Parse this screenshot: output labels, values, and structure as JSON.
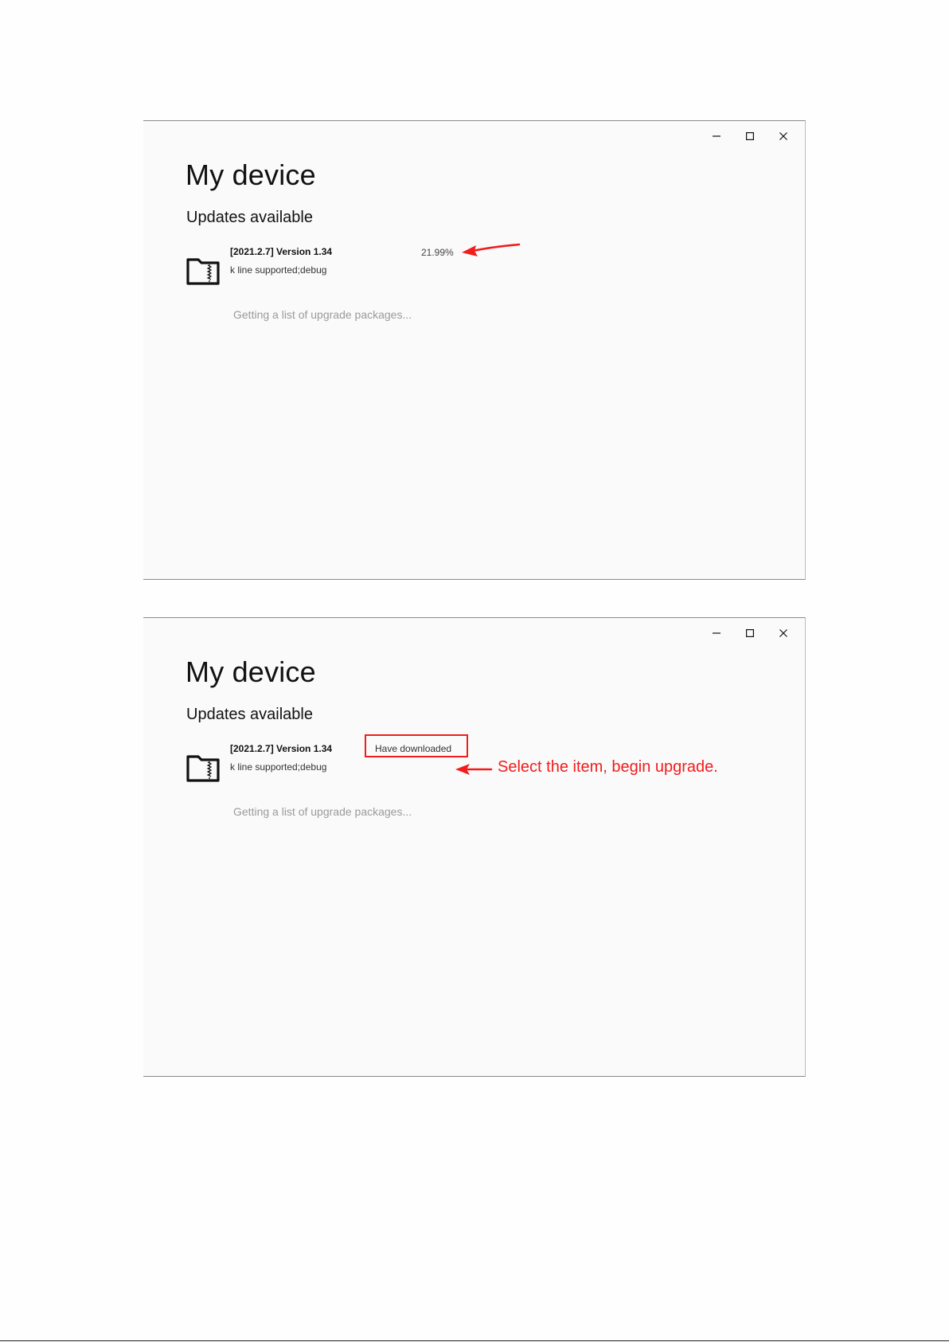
{
  "colors": {
    "annotation": "#f21c1c",
    "window_bg": "#fafafa",
    "muted_text": "#9a9a9a"
  },
  "window_controls": {
    "minimize_icon": "minimize-icon",
    "maximize_icon": "maximize-icon",
    "close_icon": "close-icon"
  },
  "screens": [
    {
      "app_title": "My device",
      "section_title": "Updates available",
      "package": {
        "icon": "sd-card-folder-icon",
        "title": "[2021.2.7] Version 1.34",
        "description": "k line supported;debug",
        "progress_text": "21.99%",
        "progress_value_percent": 21.99
      },
      "loading_text": "Getting a list of upgrade packages..."
    },
    {
      "app_title": "My device",
      "section_title": "Updates available",
      "package": {
        "icon": "sd-card-folder-icon",
        "title": "[2021.2.7] Version 1.34",
        "description": "k line supported;debug",
        "status_text": "Have downloaded"
      },
      "loading_text": "Getting a list of upgrade packages...",
      "annotation_text": "Select the item, begin upgrade."
    }
  ]
}
